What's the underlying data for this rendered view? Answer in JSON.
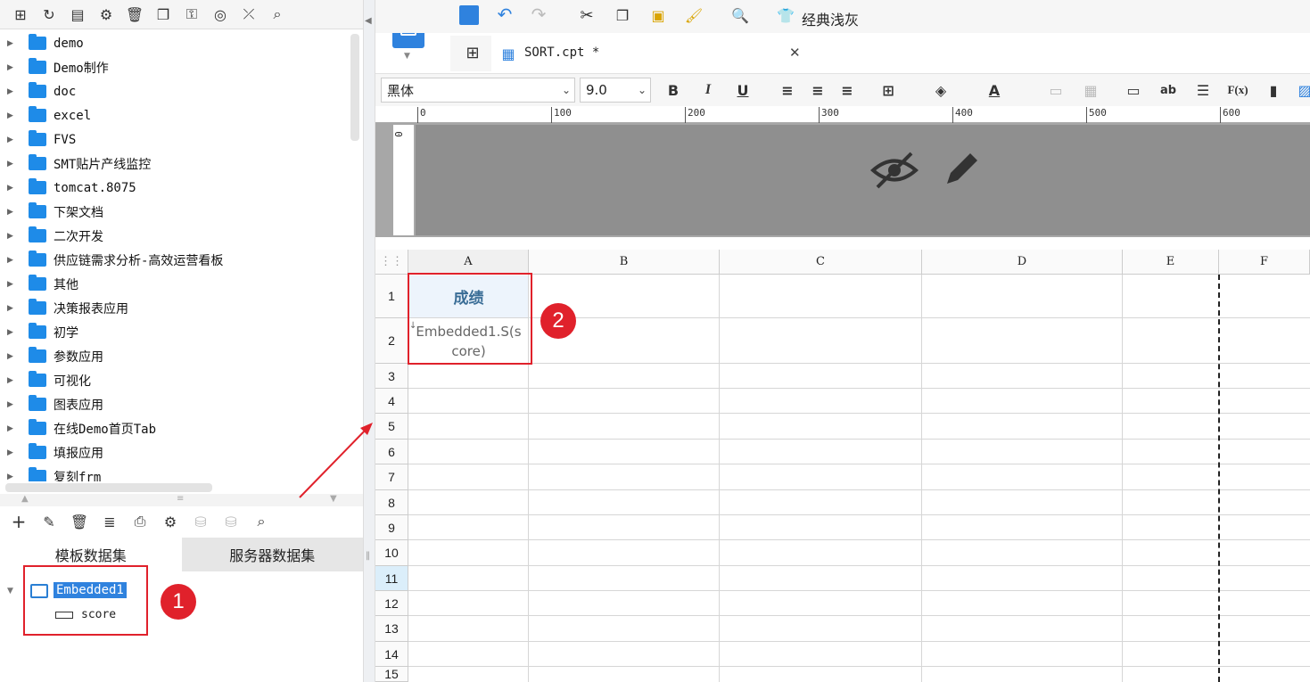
{
  "tree": {
    "folders": [
      "demo",
      "Demo制作",
      "doc",
      "excel",
      "FVS",
      "SMT贴片产线监控",
      "tomcat.8075",
      "下架文档",
      "二次开发",
      "供应链需求分析-高效运营看板",
      "其他",
      "决策报表应用",
      "初学",
      "参数应用",
      "可视化",
      "图表应用",
      "在线Demo首页Tab",
      "填报应用",
      "复刻frm"
    ]
  },
  "dataset": {
    "tabs": {
      "template": "模板数据集",
      "server": "服务器数据集"
    },
    "dataset_name": "Embedded1",
    "field": "score"
  },
  "callouts": {
    "one": "1",
    "two": "2"
  },
  "editor": {
    "tab_title": "SORT.cpt *",
    "theme_label": "经典浅灰",
    "font_family": "黑体",
    "font_size": "9.0",
    "ruler_ticks": [
      "0",
      "100",
      "200",
      "300",
      "400",
      "500",
      "600"
    ],
    "vruler_tick": "0"
  },
  "sheet": {
    "columns": [
      "A",
      "B",
      "C",
      "D",
      "E",
      "F"
    ],
    "rows": [
      "1",
      "2",
      "3",
      "4",
      "5",
      "6",
      "7",
      "8",
      "9",
      "10",
      "11",
      "12",
      "13",
      "14",
      "15"
    ],
    "cell_a1": "成绩",
    "cell_a2": "Embedded1.S(score)"
  }
}
